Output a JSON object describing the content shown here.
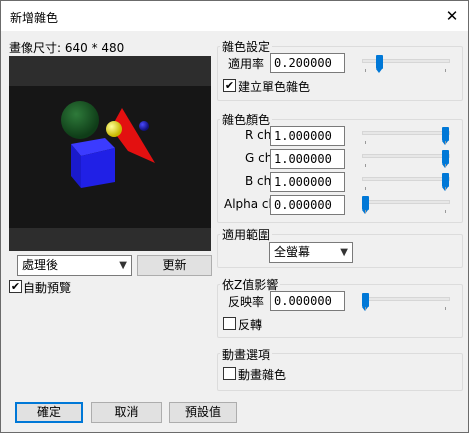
{
  "window": {
    "title": "新增雜色",
    "close_glyph": "✕"
  },
  "preview": {
    "label": "畫像尺寸: 640 * 480"
  },
  "view_select": {
    "value": "處理後"
  },
  "refresh_label": "更新",
  "auto_preview": {
    "label": "自動預覽",
    "checked": true
  },
  "noise_settings": {
    "title": "雜色設定",
    "rate_label": "適用率",
    "rate_value": "0.200000",
    "rate_slider": 0.2,
    "mono_label": "建立單色雜色",
    "mono_checked": true
  },
  "noise_color": {
    "title": "雜色顏色",
    "channels": [
      {
        "label": "R ch",
        "value": "1.000000",
        "slider": 1.0
      },
      {
        "label": "G ch",
        "value": "1.000000",
        "slider": 1.0
      },
      {
        "label": "B ch",
        "value": "1.000000",
        "slider": 1.0
      },
      {
        "label": "Alpha ch",
        "value": "0.000000",
        "slider": 0.0
      }
    ]
  },
  "range": {
    "title": "適用範圍",
    "value": "全螢幕"
  },
  "zdepth": {
    "title": "依Z值影響",
    "reflect_label": "反映率",
    "reflect_value": "0.000000",
    "reflect_slider": 0.0,
    "invert_label": "反轉",
    "invert_checked": false
  },
  "animation": {
    "title": "動畫選項",
    "noise_label": "動畫雜色",
    "noise_checked": false
  },
  "buttons": {
    "ok": "確定",
    "cancel": "取消",
    "defaults": "預設值"
  }
}
